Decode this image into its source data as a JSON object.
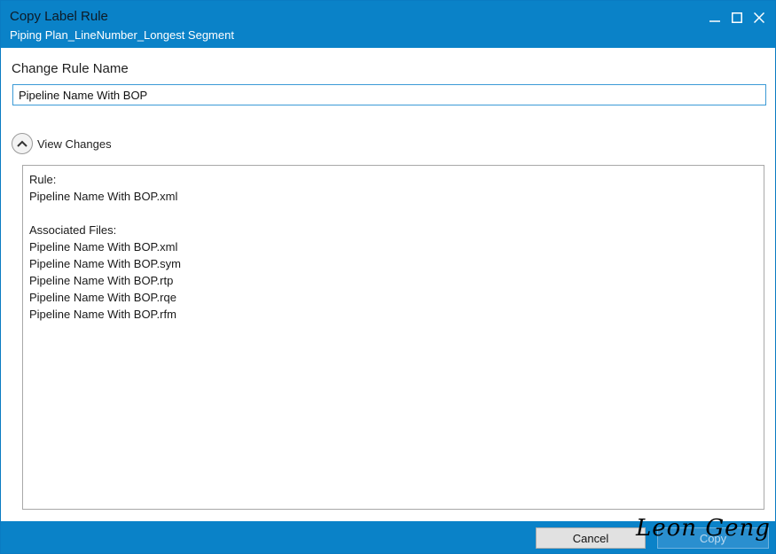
{
  "window": {
    "title": "Copy Label Rule",
    "subtitle": "Piping Plan_LineNumber_Longest Segment",
    "controls": [
      "minimize-icon",
      "maximize-icon",
      "close-icon"
    ]
  },
  "form": {
    "section_label": "Change Rule Name",
    "rule_name_value": "Pipeline Name With BOP",
    "expander_label": "View Changes",
    "expander_state": "expanded"
  },
  "changes": {
    "rule_heading": "Rule:",
    "rule_file": "Pipeline Name With BOP.xml",
    "assoc_heading": "Associated Files:",
    "files": [
      "Pipeline Name With BOP.xml",
      "Pipeline Name With BOP.sym",
      "Pipeline Name With BOP.rtp",
      "Pipeline Name With BOP.rqe",
      "Pipeline Name With BOP.rfm"
    ]
  },
  "buttons": {
    "cancel": "Cancel",
    "copy": "Copy"
  },
  "signature": "Leon Geng",
  "colors": {
    "accent": "#0a82c8",
    "input_border": "#3b9ad6"
  }
}
